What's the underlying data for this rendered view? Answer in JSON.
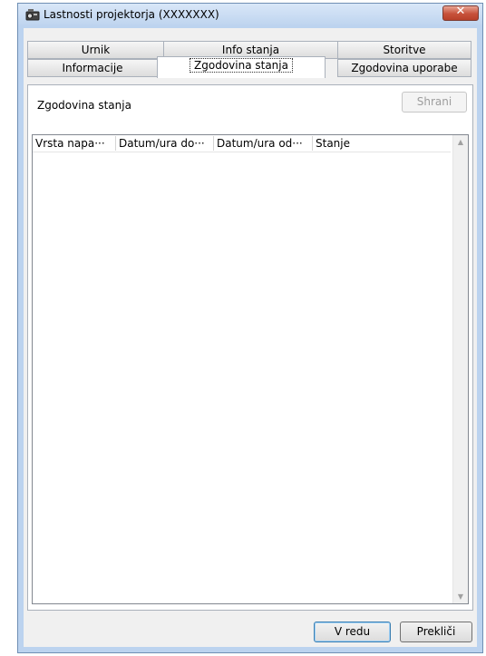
{
  "window": {
    "title": "Lastnosti projektorja (XXXXXXX)",
    "close_glyph": "✕",
    "app_icon": "projector-icon"
  },
  "tabs": {
    "row_back": [
      {
        "label": "Urnik"
      },
      {
        "label": "Info stanja"
      },
      {
        "label": "Storitve"
      }
    ],
    "row_front": [
      {
        "label": "Informacije"
      },
      {
        "label": "Zgodovina stanja",
        "active": true
      },
      {
        "label": "Zgodovina uporabe"
      }
    ]
  },
  "panel": {
    "section_label": "Zgodovina stanja",
    "save_label": "Shrani",
    "columns": [
      "Vrsta napa···",
      "Datum/ura do···",
      "Datum/ura od···",
      "Stanje"
    ],
    "rows": []
  },
  "footer": {
    "ok_label": "V redu",
    "cancel_label": "Prekliči"
  },
  "colors": {
    "frame": "#bcd3ef",
    "close_button": "#c7513a",
    "client_bg": "#f0f0f0"
  }
}
